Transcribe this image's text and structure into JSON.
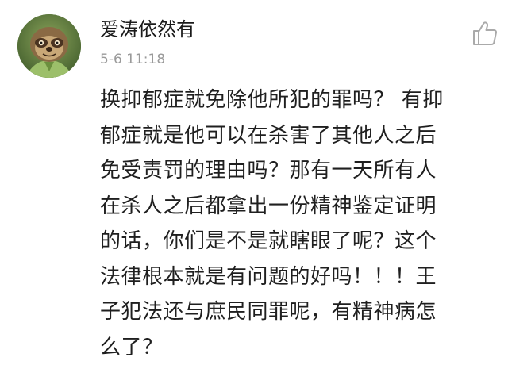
{
  "comment": {
    "username": "爱涛依然有",
    "timestamp": "5-6 11:18",
    "lines": [
      "换抑郁症就免除他所犯的罪吗？ 有抑",
      "郁症就是他可以在杀害了其他人之后",
      "免受责罚的理由吗？那有一天所有人",
      "在杀人之后都拿出一份精神鉴定证明",
      "的话，你们是不是就瞎眼了呢？这个",
      "法律根本就是有问题的好吗！！！王",
      "子犯法还与庶民同罪呢，有精神病怎",
      "么了？"
    ],
    "like_icon": "thumbs-up-icon",
    "avatar_icon": "sloth-avatar"
  },
  "colors": {
    "text": "#1f1f1f",
    "timestamp": "#9a9a9a",
    "icon": "#aaaaaa"
  }
}
